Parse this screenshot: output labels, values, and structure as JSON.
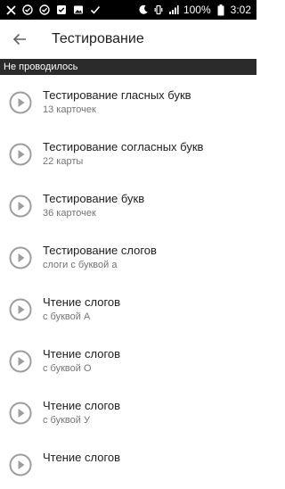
{
  "status_bar": {
    "battery_percent": "100%",
    "time": "3:02",
    "icons_left": [
      "close-icon",
      "check-circle-icon",
      "check-circle-icon",
      "checkbox-icon",
      "image-icon",
      "check-icon"
    ],
    "icons_right": [
      "moon-icon",
      "vibrate-icon",
      "signal-icon",
      "battery-icon"
    ]
  },
  "app_bar": {
    "back_icon": "arrow-back-icon",
    "title": "Тестирование"
  },
  "section": {
    "label": "Не проводилось"
  },
  "items": [
    {
      "title": "Тестирование гласных букв",
      "subtitle": "13 карточек"
    },
    {
      "title": "Тестирование согласных букв",
      "subtitle": "22 карты"
    },
    {
      "title": "Тестирование букв",
      "subtitle": "36 карточек"
    },
    {
      "title": "Тестирование слогов",
      "subtitle": "слоги с буквой а"
    },
    {
      "title": "Чтение слогов",
      "subtitle": "с буквой А"
    },
    {
      "title": "Чтение слогов",
      "subtitle": "с буквой О"
    },
    {
      "title": "Чтение слогов",
      "subtitle": "с буквой У"
    },
    {
      "title": "Чтение слогов",
      "subtitle": ""
    }
  ],
  "colors": {
    "status_bar_bg": "#000000",
    "section_bg": "#2b2b2b",
    "icon_gray": "#9e9e9e"
  }
}
